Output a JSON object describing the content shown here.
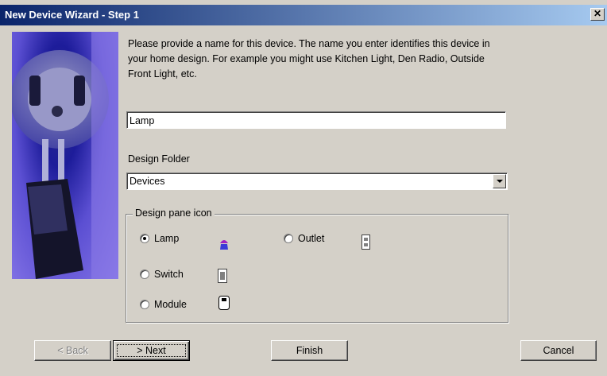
{
  "window": {
    "title": "New Device Wizard - Step 1",
    "close_label": "✕"
  },
  "description": "Please provide a name for this device.  The name you enter identifies this device in your home design.  For example you might use Kitchen Light, Den Radio, Outside Front Light, etc.",
  "device_name": {
    "value": "Lamp"
  },
  "design_folder": {
    "label": "Design Folder",
    "selected": "Devices"
  },
  "design_pane_icon": {
    "legend": "Design pane icon",
    "options": [
      {
        "label": "Lamp",
        "selected": true,
        "icon": "lamp-icon"
      },
      {
        "label": "Outlet",
        "selected": false,
        "icon": "outlet-icon"
      },
      {
        "label": "Switch",
        "selected": false,
        "icon": "switch-icon"
      },
      {
        "label": "Module",
        "selected": false,
        "icon": "module-icon"
      }
    ]
  },
  "buttons": {
    "back": "< Back",
    "next": "> Next",
    "finish": "Finish",
    "cancel": "Cancel"
  },
  "colors": {
    "titlebar_start": "#0a246a",
    "titlebar_end": "#a6caf0",
    "dialog_bg": "#d4d0c8",
    "lamp_icon": "#3b3bd8"
  }
}
